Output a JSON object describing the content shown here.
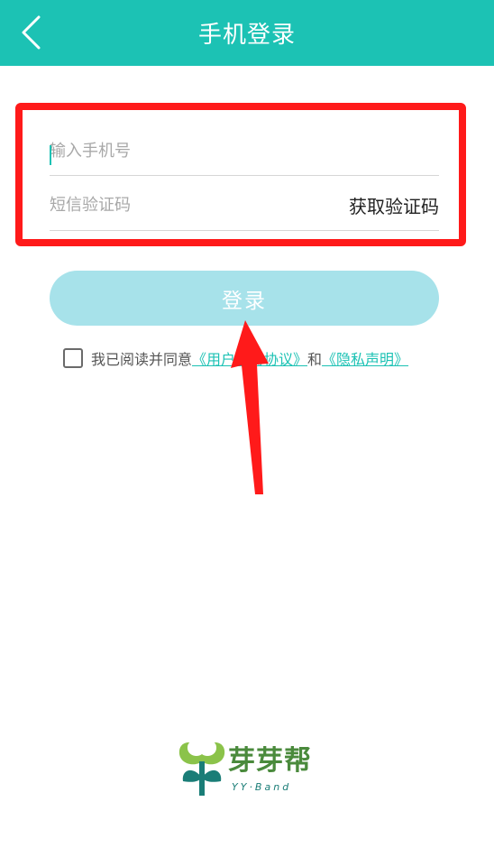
{
  "header": {
    "title": "手机登录",
    "back_icon": "chevron-left-icon",
    "background_color": "#1cc2b4"
  },
  "form": {
    "phone_placeholder": "输入手机号",
    "sms_placeholder": "短信验证码",
    "get_code_label": "获取验证码"
  },
  "login": {
    "button_label": "登录",
    "button_color": "#a7e2ea"
  },
  "agreement": {
    "prefix": "我已阅读并同意",
    "terms_link": "《用户服务协议》",
    "and_text": "和",
    "privacy_link": "《隐私声明》",
    "link_color": "#1cc2b4"
  },
  "annotation": {
    "highlight_color": "#ff1a1a"
  },
  "logo": {
    "name_cn": "芽芽帮",
    "name_en": "YY·Band",
    "brand_green": "#4a8a3c",
    "brand_teal": "#1a7d77"
  }
}
